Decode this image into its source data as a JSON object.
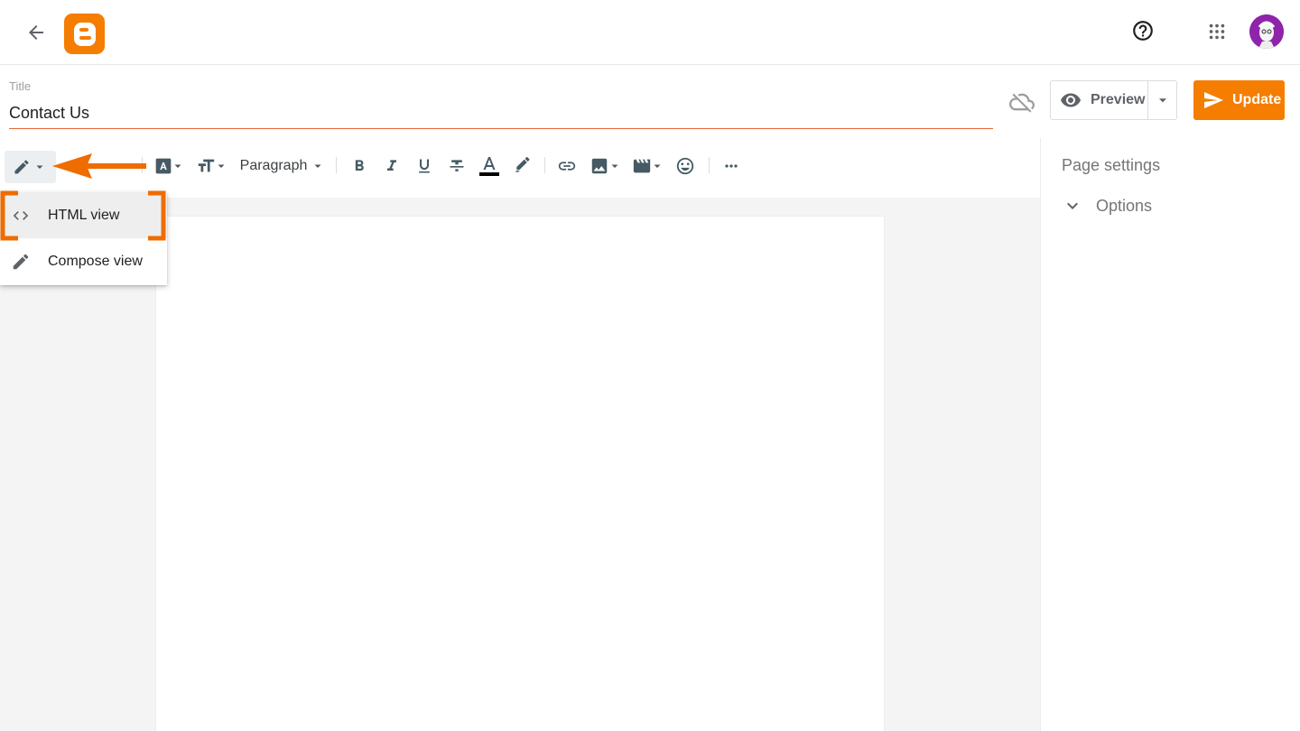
{
  "header": {
    "back_icon": "arrow-back-icon",
    "logo_icon": "blogger-logo-icon",
    "help_icon": "help-circle-icon",
    "apps_icon": "apps-grid-icon",
    "avatar_icon": "avatar-image"
  },
  "title_field": {
    "label": "Title",
    "value": "Contact Us"
  },
  "actions": {
    "sync_icon": "cloud-off-icon",
    "preview_label": "Preview",
    "update_label": "Update"
  },
  "toolbar": {
    "mode_icon": "pencil-icon",
    "font_icon": "font-icon",
    "text_size_icon": "text-size-icon",
    "paragraph_label": "Paragraph",
    "bold_icon": "bold-icon",
    "italic_icon": "italic-icon",
    "underline_icon": "underline-icon",
    "strikethrough_icon": "strikethrough-icon",
    "text_color_icon": "text-color-icon",
    "highlight_icon": "highlighter-icon",
    "link_icon": "link-icon",
    "image_icon": "image-icon",
    "video_icon": "video-icon",
    "emoji_icon": "emoji-icon",
    "more_icon": "more-horizontal-icon"
  },
  "mode_menu": {
    "items": [
      {
        "label": "HTML view",
        "icon": "code-icon",
        "active": true
      },
      {
        "label": "Compose view",
        "icon": "pencil-icon",
        "active": false
      }
    ]
  },
  "side_panel": {
    "title": "Page settings",
    "options_label": "Options"
  },
  "colors": {
    "brand_orange": "#f57d00",
    "annotation_orange": "#ef6c00",
    "icon_gray": "#5f6368"
  }
}
